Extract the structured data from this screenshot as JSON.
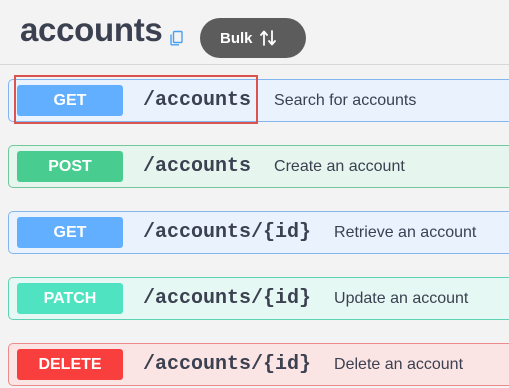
{
  "header": {
    "title": "accounts",
    "copy_icon": "copy-icon",
    "bulk_button": {
      "label": "Bulk",
      "icon": "sort-arrows-icon",
      "color": "#5c5c5c"
    }
  },
  "operations": [
    {
      "method": "GET",
      "path": "/accounts",
      "summary": "Search for accounts",
      "highlighted": true
    },
    {
      "method": "POST",
      "path": "/accounts",
      "summary": "Create an account"
    },
    {
      "method": "GET",
      "path": "/accounts/{id}",
      "summary": "Retrieve an account"
    },
    {
      "method": "PATCH",
      "path": "/accounts/{id}",
      "summary": "Update an account"
    },
    {
      "method": "DELETE",
      "path": "/accounts/{id}",
      "summary": "Delete an account"
    }
  ],
  "colors": {
    "get": "#61affe",
    "post": "#49cc90",
    "patch": "#50e3c2",
    "delete": "#f93e3e",
    "highlight": "#d9534f"
  }
}
